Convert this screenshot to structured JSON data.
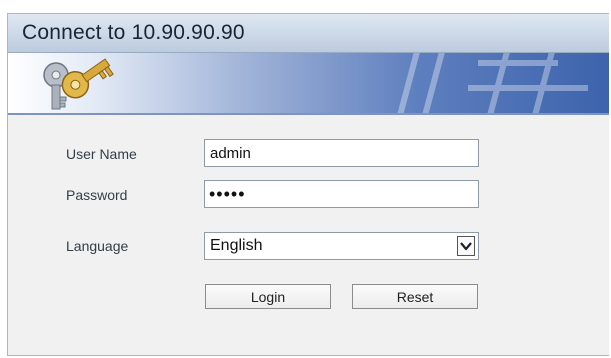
{
  "dialog": {
    "title": "Connect to 10.90.90.90"
  },
  "banner": {
    "icon": "keys-icon"
  },
  "form": {
    "username": {
      "label": "User Name",
      "value": "admin"
    },
    "password": {
      "label": "Password",
      "masked_value": "•••••"
    },
    "language": {
      "label": "Language",
      "selected": "English"
    }
  },
  "buttons": {
    "login": "Login",
    "reset": "Reset"
  },
  "colors": {
    "banner_accent": "#3d63ac",
    "title_bar": "#cfdbe9",
    "content_background": "#f1f1f2"
  }
}
